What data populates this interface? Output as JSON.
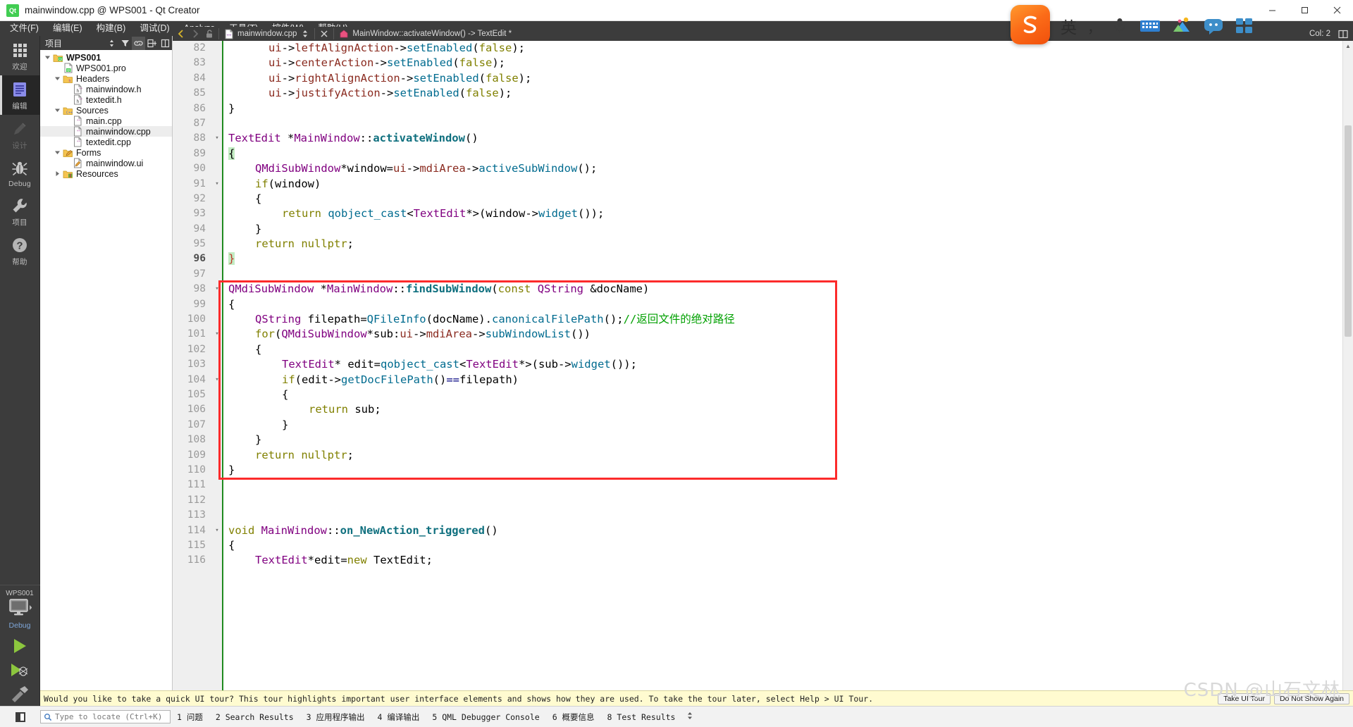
{
  "window": {
    "title": "mainwindow.cpp @ WPS001 - Qt Creator",
    "app_badge": "Qt",
    "minimize": "minimize-button",
    "maximize": "maximize-button",
    "close": "close-button"
  },
  "menu": {
    "items": [
      {
        "label": "文件(F)",
        "key": "F"
      },
      {
        "label": "编辑(E)",
        "key": "E"
      },
      {
        "label": "构建(B)",
        "key": "B"
      },
      {
        "label": "调试(D)",
        "key": "D"
      },
      {
        "label": "Analyze",
        "key": "A"
      },
      {
        "label": "工具(T)",
        "key": "T"
      },
      {
        "label": "控件(W)",
        "key": "W"
      },
      {
        "label": "帮助(H)",
        "key": "H"
      }
    ]
  },
  "modes": {
    "items": [
      {
        "label": "欢迎",
        "icon": "grid-icon",
        "state": "normal"
      },
      {
        "label": "编辑",
        "icon": "document-icon",
        "state": "active"
      },
      {
        "label": "设计",
        "icon": "pencil-icon",
        "state": "disabled"
      },
      {
        "label": "Debug",
        "icon": "bug-icon",
        "state": "normal"
      },
      {
        "label": "项目",
        "icon": "wrench-icon",
        "state": "normal"
      },
      {
        "label": "帮助",
        "icon": "question-icon",
        "state": "normal"
      }
    ],
    "kit": {
      "project_name": "WPS001",
      "build_config": "Debug",
      "icon": "monitor-icon"
    },
    "run_buttons": [
      {
        "name": "run-button",
        "icon": "play-icon"
      },
      {
        "name": "debug-button",
        "icon": "play-bug-icon"
      },
      {
        "name": "build-button",
        "icon": "hammer-icon"
      }
    ]
  },
  "project_pane": {
    "title": "项目",
    "header_buttons": [
      {
        "name": "filter-sort-button",
        "icon": "sort-icon"
      },
      {
        "name": "filter-button",
        "icon": "funnel-icon"
      },
      {
        "name": "sync-with-editor-button",
        "icon": "link-icon",
        "active": true
      },
      {
        "name": "split-button",
        "icon": "split-icon"
      },
      {
        "name": "close-pane-button",
        "icon": "close-pane-icon"
      }
    ],
    "tree": [
      {
        "label": "WPS001",
        "depth": 0,
        "expander": "down",
        "icon": "qt-project-icon",
        "bold": true,
        "selected": false
      },
      {
        "label": "WPS001.pro",
        "depth": 1,
        "expander": "none",
        "icon": "pro-file-icon",
        "bold": false,
        "selected": false
      },
      {
        "label": "Headers",
        "depth": 1,
        "expander": "down",
        "icon": "folder-h-icon",
        "bold": false,
        "selected": false
      },
      {
        "label": "mainwindow.h",
        "depth": 2,
        "expander": "none",
        "icon": "h-file-icon",
        "bold": false,
        "selected": false
      },
      {
        "label": "textedit.h",
        "depth": 2,
        "expander": "none",
        "icon": "h-file-icon",
        "bold": false,
        "selected": false
      },
      {
        "label": "Sources",
        "depth": 1,
        "expander": "down",
        "icon": "folder-cpp-icon",
        "bold": false,
        "selected": false
      },
      {
        "label": "main.cpp",
        "depth": 2,
        "expander": "none",
        "icon": "cpp-file-icon",
        "bold": false,
        "selected": false
      },
      {
        "label": "mainwindow.cpp",
        "depth": 2,
        "expander": "none",
        "icon": "cpp-file-icon",
        "bold": false,
        "selected": true
      },
      {
        "label": "textedit.cpp",
        "depth": 2,
        "expander": "none",
        "icon": "cpp-file-icon",
        "bold": false,
        "selected": false
      },
      {
        "label": "Forms",
        "depth": 1,
        "expander": "down",
        "icon": "folder-ui-icon",
        "bold": false,
        "selected": false
      },
      {
        "label": "mainwindow.ui",
        "depth": 2,
        "expander": "none",
        "icon": "ui-file-icon",
        "bold": false,
        "selected": false
      },
      {
        "label": "Resources",
        "depth": 1,
        "expander": "right",
        "icon": "folder-res-icon",
        "bold": false,
        "selected": false
      }
    ]
  },
  "editor_toolbar": {
    "back_button": "back-icon",
    "forward_button": "forward-icon",
    "lock_button": "unlocked-icon",
    "file_combo": "mainwindow.cpp",
    "file_combo_icon": "cpp-file-icon",
    "split_button": "updown-icon",
    "close_button": "close-icon",
    "symbol_combo": "MainWindow::activateWindow() -> TextEdit *",
    "symbol_icon": "function-icon",
    "column_label": "Col: 2",
    "split_editor_button": "split-editor-icon"
  },
  "editor": {
    "first_line": 82,
    "current_line": 96,
    "highlight_box_lines": [
      98,
      110
    ],
    "lines": [
      {
        "n": 82,
        "fold": "",
        "indent": 3,
        "tokens": [
          {
            "t": "ui",
            "c": "var"
          },
          {
            "t": "->",
            "c": "op"
          },
          {
            "t": "leftAlignAction",
            "c": "var"
          },
          {
            "t": "->",
            "c": "op"
          },
          {
            "t": "setEnabled",
            "c": "call"
          },
          {
            "t": "(",
            "c": "op"
          },
          {
            "t": "false",
            "c": "kw"
          },
          {
            "t": ");",
            "c": "op"
          }
        ]
      },
      {
        "n": 83,
        "fold": "",
        "indent": 3,
        "tokens": [
          {
            "t": "ui",
            "c": "var"
          },
          {
            "t": "->",
            "c": "op"
          },
          {
            "t": "centerAction",
            "c": "var"
          },
          {
            "t": "->",
            "c": "op"
          },
          {
            "t": "setEnabled",
            "c": "call"
          },
          {
            "t": "(",
            "c": "op"
          },
          {
            "t": "false",
            "c": "kw"
          },
          {
            "t": ");",
            "c": "op"
          }
        ]
      },
      {
        "n": 84,
        "fold": "",
        "indent": 3,
        "tokens": [
          {
            "t": "ui",
            "c": "var"
          },
          {
            "t": "->",
            "c": "op"
          },
          {
            "t": "rightAlignAction",
            "c": "var"
          },
          {
            "t": "->",
            "c": "op"
          },
          {
            "t": "setEnabled",
            "c": "call"
          },
          {
            "t": "(",
            "c": "op"
          },
          {
            "t": "false",
            "c": "kw"
          },
          {
            "t": ");",
            "c": "op"
          }
        ]
      },
      {
        "n": 85,
        "fold": "",
        "indent": 3,
        "tokens": [
          {
            "t": "ui",
            "c": "var"
          },
          {
            "t": "->",
            "c": "op"
          },
          {
            "t": "justifyAction",
            "c": "var"
          },
          {
            "t": "->",
            "c": "op"
          },
          {
            "t": "setEnabled",
            "c": "call"
          },
          {
            "t": "(",
            "c": "op"
          },
          {
            "t": "false",
            "c": "kw"
          },
          {
            "t": ");",
            "c": "op"
          }
        ]
      },
      {
        "n": 86,
        "fold": "",
        "indent": 0,
        "tokens": [
          {
            "t": "}",
            "c": "op"
          }
        ]
      },
      {
        "n": 87,
        "fold": "",
        "indent": 0,
        "tokens": []
      },
      {
        "n": 88,
        "fold": "▾",
        "indent": 0,
        "tokens": [
          {
            "t": "TextEdit",
            "c": "type"
          },
          {
            "t": " *",
            "c": "op"
          },
          {
            "t": "MainWindow",
            "c": "type"
          },
          {
            "t": "::",
            "c": "op"
          },
          {
            "t": "activateWindow",
            "c": "fn"
          },
          {
            "t": "()",
            "c": "op"
          }
        ]
      },
      {
        "n": 89,
        "fold": "",
        "indent": 0,
        "tokens": [
          {
            "t": "{",
            "c": "op",
            "hl": true
          }
        ]
      },
      {
        "n": 90,
        "fold": "",
        "indent": 2,
        "tokens": [
          {
            "t": "QMdiSubWindow",
            "c": "type"
          },
          {
            "t": "*window=",
            "c": "op"
          },
          {
            "t": "ui",
            "c": "var"
          },
          {
            "t": "->",
            "c": "op"
          },
          {
            "t": "mdiArea",
            "c": "var"
          },
          {
            "t": "->",
            "c": "op"
          },
          {
            "t": "activeSubWindow",
            "c": "call"
          },
          {
            "t": "();",
            "c": "op"
          }
        ]
      },
      {
        "n": 91,
        "fold": "▾",
        "indent": 2,
        "tokens": [
          {
            "t": "if",
            "c": "kw"
          },
          {
            "t": "(window)",
            "c": "op"
          }
        ]
      },
      {
        "n": 92,
        "fold": "",
        "indent": 2,
        "tokens": [
          {
            "t": "{",
            "c": "op"
          }
        ]
      },
      {
        "n": 93,
        "fold": "",
        "indent": 4,
        "tokens": [
          {
            "t": "return",
            "c": "kw"
          },
          {
            "t": " ",
            "c": "op"
          },
          {
            "t": "qobject_cast",
            "c": "call"
          },
          {
            "t": "<",
            "c": "op"
          },
          {
            "t": "TextEdit",
            "c": "type"
          },
          {
            "t": "*>(window->",
            "c": "op"
          },
          {
            "t": "widget",
            "c": "call"
          },
          {
            "t": "());",
            "c": "op"
          }
        ]
      },
      {
        "n": 94,
        "fold": "",
        "indent": 2,
        "tokens": [
          {
            "t": "}",
            "c": "op"
          }
        ]
      },
      {
        "n": 95,
        "fold": "",
        "indent": 2,
        "tokens": [
          {
            "t": "return",
            "c": "kw"
          },
          {
            "t": " ",
            "c": "op"
          },
          {
            "t": "nullptr",
            "c": "kw"
          },
          {
            "t": ";",
            "c": "op"
          }
        ]
      },
      {
        "n": 96,
        "fold": "",
        "indent": 0,
        "tokens": [
          {
            "t": "}",
            "c": "op",
            "hl": true,
            "red": true
          }
        ],
        "current": true
      },
      {
        "n": 97,
        "fold": "",
        "indent": 0,
        "tokens": []
      },
      {
        "n": 98,
        "fold": "▾",
        "indent": 0,
        "tokens": [
          {
            "t": "QMdiSubWindow",
            "c": "type"
          },
          {
            "t": " *",
            "c": "op"
          },
          {
            "t": "MainWindow",
            "c": "type"
          },
          {
            "t": "::",
            "c": "op"
          },
          {
            "t": "findSubWindow",
            "c": "fn"
          },
          {
            "t": "(",
            "c": "op"
          },
          {
            "t": "const",
            "c": "kw"
          },
          {
            "t": " ",
            "c": "op"
          },
          {
            "t": "QString",
            "c": "type"
          },
          {
            "t": " &docName)",
            "c": "op"
          }
        ]
      },
      {
        "n": 99,
        "fold": "",
        "indent": 0,
        "tokens": [
          {
            "t": "{",
            "c": "op"
          }
        ]
      },
      {
        "n": 100,
        "fold": "",
        "indent": 2,
        "tokens": [
          {
            "t": "QString",
            "c": "type"
          },
          {
            "t": " filepath=",
            "c": "op"
          },
          {
            "t": "QFileInfo",
            "c": "call"
          },
          {
            "t": "(docName).",
            "c": "op"
          },
          {
            "t": "canonicalFilePath",
            "c": "call"
          },
          {
            "t": "();",
            "c": "op"
          },
          {
            "t": "//返回文件的绝对路径",
            "c": "cmt"
          }
        ]
      },
      {
        "n": 101,
        "fold": "▾",
        "indent": 2,
        "tokens": [
          {
            "t": "for",
            "c": "kw"
          },
          {
            "t": "(",
            "c": "op"
          },
          {
            "t": "QMdiSubWindow",
            "c": "type"
          },
          {
            "t": "*sub:",
            "c": "op"
          },
          {
            "t": "ui",
            "c": "var"
          },
          {
            "t": "->",
            "c": "op"
          },
          {
            "t": "mdiArea",
            "c": "var"
          },
          {
            "t": "->",
            "c": "op"
          },
          {
            "t": "subWindowList",
            "c": "call"
          },
          {
            "t": "())",
            "c": "op"
          }
        ]
      },
      {
        "n": 102,
        "fold": "",
        "indent": 2,
        "tokens": [
          {
            "t": "{",
            "c": "op"
          }
        ]
      },
      {
        "n": 103,
        "fold": "",
        "indent": 4,
        "tokens": [
          {
            "t": "TextEdit",
            "c": "type"
          },
          {
            "t": "* edit=",
            "c": "op"
          },
          {
            "t": "qobject_cast",
            "c": "call"
          },
          {
            "t": "<",
            "c": "op"
          },
          {
            "t": "TextEdit",
            "c": "type"
          },
          {
            "t": "*>(sub->",
            "c": "op"
          },
          {
            "t": "widget",
            "c": "call"
          },
          {
            "t": "());",
            "c": "op"
          }
        ]
      },
      {
        "n": 104,
        "fold": "▾",
        "indent": 4,
        "tokens": [
          {
            "t": "if",
            "c": "kw"
          },
          {
            "t": "(edit->",
            "c": "op"
          },
          {
            "t": "getDocFilePath",
            "c": "call"
          },
          {
            "t": "()",
            "c": "op"
          },
          {
            "t": "==",
            "c": "num"
          },
          {
            "t": "filepath)",
            "c": "op"
          }
        ]
      },
      {
        "n": 105,
        "fold": "",
        "indent": 4,
        "tokens": [
          {
            "t": "{",
            "c": "op"
          }
        ]
      },
      {
        "n": 106,
        "fold": "",
        "indent": 6,
        "tokens": [
          {
            "t": "return",
            "c": "kw"
          },
          {
            "t": " sub;",
            "c": "op"
          }
        ]
      },
      {
        "n": 107,
        "fold": "",
        "indent": 4,
        "tokens": [
          {
            "t": "}",
            "c": "op"
          }
        ]
      },
      {
        "n": 108,
        "fold": "",
        "indent": 2,
        "tokens": [
          {
            "t": "}",
            "c": "op"
          }
        ]
      },
      {
        "n": 109,
        "fold": "",
        "indent": 2,
        "tokens": [
          {
            "t": "return",
            "c": "kw"
          },
          {
            "t": " ",
            "c": "op"
          },
          {
            "t": "nullptr",
            "c": "kw"
          },
          {
            "t": ";",
            "c": "op"
          }
        ]
      },
      {
        "n": 110,
        "fold": "",
        "indent": 0,
        "tokens": [
          {
            "t": "}",
            "c": "op"
          }
        ]
      },
      {
        "n": 111,
        "fold": "",
        "indent": 0,
        "tokens": []
      },
      {
        "n": 112,
        "fold": "",
        "indent": 0,
        "tokens": []
      },
      {
        "n": 113,
        "fold": "",
        "indent": 0,
        "tokens": []
      },
      {
        "n": 114,
        "fold": "▾",
        "indent": 0,
        "tokens": [
          {
            "t": "void",
            "c": "kw"
          },
          {
            "t": " ",
            "c": "op"
          },
          {
            "t": "MainWindow",
            "c": "type"
          },
          {
            "t": "::",
            "c": "op"
          },
          {
            "t": "on_NewAction_triggered",
            "c": "fn"
          },
          {
            "t": "()",
            "c": "op"
          }
        ]
      },
      {
        "n": 115,
        "fold": "",
        "indent": 0,
        "tokens": [
          {
            "t": "{",
            "c": "op"
          }
        ]
      },
      {
        "n": 116,
        "fold": "",
        "indent": 2,
        "tokens": [
          {
            "t": "TextEdit",
            "c": "type"
          },
          {
            "t": "*edit=",
            "c": "op"
          },
          {
            "t": "new",
            "c": "kw"
          },
          {
            "t": " TextEdit;",
            "c": "op"
          }
        ]
      }
    ]
  },
  "tour": {
    "message": "Would you like to take a quick UI tour? This tour highlights important user interface elements and shows how they are used. To take the tour later, select Help > UI Tour.",
    "take_tour_label": "Take UI Tour",
    "dismiss_label": "Do Not Show Again"
  },
  "statusbar": {
    "locator_placeholder": "Type to locate (Ctrl+K)",
    "search_icon": "search-icon",
    "tabs": [
      {
        "num": "1",
        "label": "问题"
      },
      {
        "num": "2",
        "label": "Search Results"
      },
      {
        "num": "3",
        "label": "应用程序输出"
      },
      {
        "num": "4",
        "label": "编译输出"
      },
      {
        "num": "5",
        "label": "QML Debugger Console"
      },
      {
        "num": "6",
        "label": "概要信息"
      },
      {
        "num": "8",
        "label": "Test Results"
      }
    ],
    "updown_icon": "updown-icon"
  },
  "ime": {
    "logo": "sogou-input-logo",
    "mode_label": "英",
    "punctuation_label": "，",
    "buttons": [
      {
        "name": "voice-input-button",
        "icon": "microphone-icon"
      },
      {
        "name": "soft-keyboard-button",
        "icon": "keyboard-icon"
      },
      {
        "name": "skin-button",
        "icon": "palette-icon"
      },
      {
        "name": "emoji-button",
        "icon": "emoji-icon"
      },
      {
        "name": "toolbox-button",
        "icon": "grid-apps-icon"
      }
    ]
  },
  "watermark": {
    "text": "CSDN @山石文林"
  },
  "colors": {
    "accent": "#41cd52",
    "menubar_bg": "#3c3c3c",
    "annotation_red": "#fc2b2b",
    "comment_green": "#00a000",
    "modified_marker": "#1f8a1f"
  }
}
